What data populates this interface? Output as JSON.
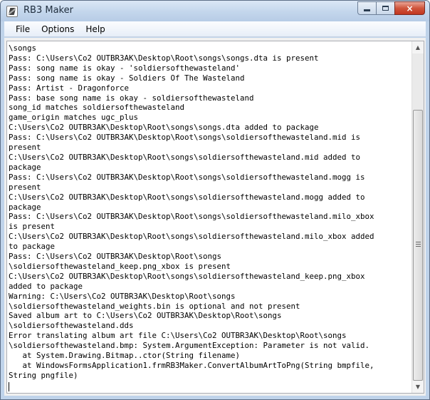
{
  "window": {
    "title": "RB3 Maker",
    "close_glyph": "×"
  },
  "icons": {
    "app": "rb3-maker-app-icon",
    "minimize": "minimize-icon",
    "maximize": "maximize-icon",
    "close": "close-icon",
    "scroll_up": "▲",
    "scroll_down": "▼"
  },
  "menu": {
    "items": [
      "File",
      "Options",
      "Help"
    ]
  },
  "log": {
    "lines": [
      "\\songs",
      "Pass: C:\\Users\\Co2 OUTBR3AK\\Desktop\\Root\\songs\\songs.dta is present",
      "Pass: song name is okay - 'soldiersofthewasteland'",
      "Pass: song name is okay - Soldiers Of The Wasteland",
      "Pass: Artist - Dragonforce",
      "Pass: base song name is okay - soldiersofthewasteland",
      "song_id matches soldiersofthewasteland",
      "game_origin matches ugc_plus",
      "C:\\Users\\Co2 OUTBR3AK\\Desktop\\Root\\songs\\songs.dta added to package",
      "Pass: C:\\Users\\Co2 OUTBR3AK\\Desktop\\Root\\songs\\soldiersofthewasteland.mid is",
      "present",
      "C:\\Users\\Co2 OUTBR3AK\\Desktop\\Root\\songs\\soldiersofthewasteland.mid added to",
      "package",
      "Pass: C:\\Users\\Co2 OUTBR3AK\\Desktop\\Root\\songs\\soldiersofthewasteland.mogg is",
      "present",
      "C:\\Users\\Co2 OUTBR3AK\\Desktop\\Root\\songs\\soldiersofthewasteland.mogg added to",
      "package",
      "Pass: C:\\Users\\Co2 OUTBR3AK\\Desktop\\Root\\songs\\soldiersofthewasteland.milo_xbox",
      "is present",
      "C:\\Users\\Co2 OUTBR3AK\\Desktop\\Root\\songs\\soldiersofthewasteland.milo_xbox added",
      "to package",
      "Pass: C:\\Users\\Co2 OUTBR3AK\\Desktop\\Root\\songs",
      "\\soldiersofthewasteland_keep.png_xbox is present",
      "C:\\Users\\Co2 OUTBR3AK\\Desktop\\Root\\songs\\soldiersofthewasteland_keep.png_xbox",
      "added to package",
      "Warning: C:\\Users\\Co2 OUTBR3AK\\Desktop\\Root\\songs",
      "\\soldiersofthewasteland_weights.bin is optional and not present",
      "Saved album art to C:\\Users\\Co2 OUTBR3AK\\Desktop\\Root\\songs",
      "\\soldiersofthewasteland.dds",
      "Error translating album art file C:\\Users\\Co2 OUTBR3AK\\Desktop\\Root\\songs",
      "\\soldiersofthewasteland.bmp: System.ArgumentException: Parameter is not valid.",
      "   at System.Drawing.Bitmap..ctor(String filename)",
      "   at WindowsFormsApplication1.frmRB3Maker.ConvertAlbumArtToPng(String bmpfile,",
      "String pngfile)"
    ]
  }
}
